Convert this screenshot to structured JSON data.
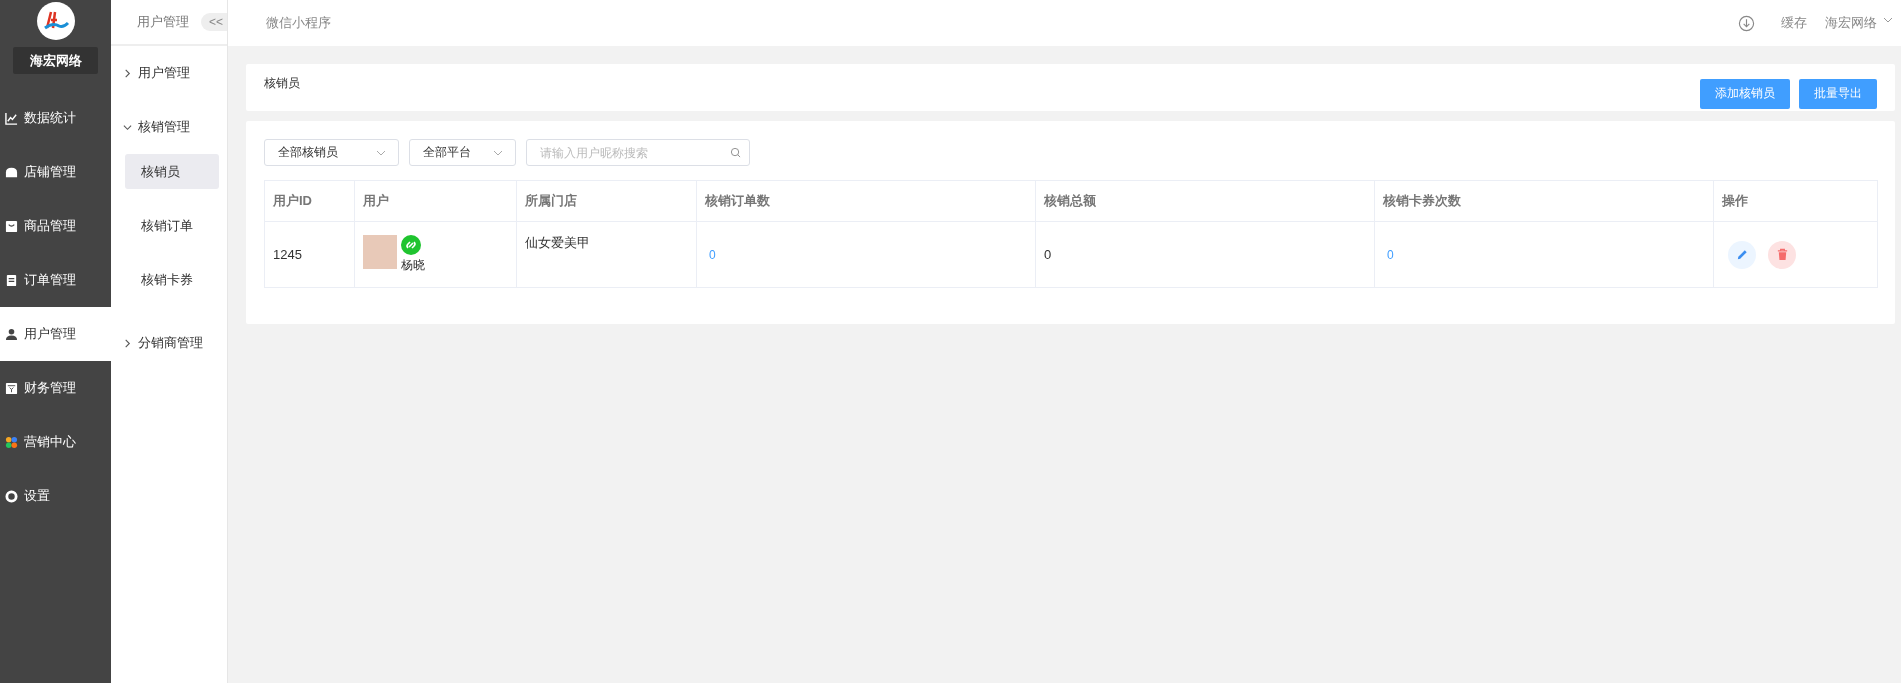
{
  "brand": {
    "name": "海宏网络"
  },
  "nav": [
    {
      "label": "数据统计",
      "kind": "chart",
      "selected": false
    },
    {
      "label": "店铺管理",
      "kind": "shop",
      "selected": false
    },
    {
      "label": "商品管理",
      "kind": "goods",
      "selected": false
    },
    {
      "label": "订单管理",
      "kind": "order",
      "selected": false
    },
    {
      "label": "用户管理",
      "kind": "user",
      "selected": true
    },
    {
      "label": "财务管理",
      "kind": "finance",
      "selected": false
    },
    {
      "label": "营销中心",
      "kind": "marketing",
      "selected": false
    },
    {
      "label": "设置",
      "kind": "settings",
      "selected": false
    }
  ],
  "subnav": {
    "title": "用户管理",
    "collapse": "<<",
    "groups": [
      {
        "label": "用户管理",
        "expanded": false
      },
      {
        "label": "核销管理",
        "expanded": true,
        "children": [
          {
            "label": "核销员",
            "selected": true
          },
          {
            "label": "核销订单",
            "selected": false
          },
          {
            "label": "核销卡券",
            "selected": false
          }
        ]
      },
      {
        "label": "分销商管理",
        "expanded": false
      }
    ]
  },
  "topbar": {
    "tab": "微信小程序",
    "cache": "缓存",
    "account": "海宏网络"
  },
  "page": {
    "title": "核销员",
    "buttons": [
      "添加核销员",
      "批量导出"
    ]
  },
  "filters": [
    {
      "kind": "select",
      "value": "全部核销员"
    },
    {
      "kind": "select",
      "value": "全部平台"
    },
    {
      "kind": "search",
      "placeholder": "请输入用户昵称搜索"
    }
  ],
  "table": {
    "columns": [
      "用户ID",
      "用户",
      "所属门店",
      "核销订单数",
      "核销总额",
      "核销卡券次数",
      "操作"
    ],
    "rows": [
      {
        "user_id": "1245",
        "user_name": "杨晓",
        "store": "仙女爱美甲",
        "order_count": "0",
        "total_amount": "0",
        "coupon_count": "0"
      }
    ]
  }
}
